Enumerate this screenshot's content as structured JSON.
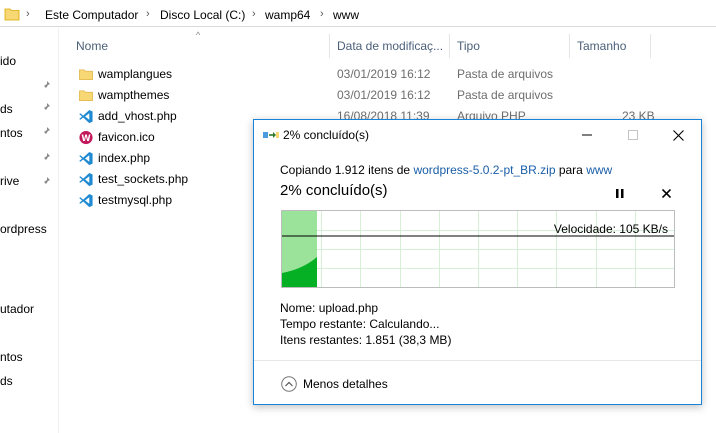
{
  "explorer": {
    "breadcrumb": [
      "Este Computador",
      "Disco Local (C:)",
      "wamp64",
      "www"
    ],
    "sidebar_items": [
      "ido",
      "ds",
      "ntos",
      "rive",
      "ordpress",
      "utador",
      "ntos",
      "ds"
    ],
    "columns": {
      "name": "Nome",
      "date": "Data de modificaç...",
      "type": "Tipo",
      "size": "Tamanho"
    },
    "files": [
      {
        "name": "wamplangues",
        "date": "03/01/2019 16:12",
        "type": "Pasta de arquivos",
        "size": "",
        "icon": "folder-icon"
      },
      {
        "name": "wampthemes",
        "date": "03/01/2019 16:12",
        "type": "Pasta de arquivos",
        "size": "",
        "icon": "folder-icon"
      },
      {
        "name": "add_vhost.php",
        "date": "16/08/2018 11:39",
        "type": "Arquivo PHP",
        "size": "23 KB",
        "icon": "vscode-file-icon"
      },
      {
        "name": "favicon.ico",
        "date": "",
        "type": "",
        "size": "",
        "icon": "ico-file-icon"
      },
      {
        "name": "index.php",
        "date": "",
        "type": "",
        "size": "",
        "icon": "vscode-file-icon"
      },
      {
        "name": "test_sockets.php",
        "date": "",
        "type": "",
        "size": "",
        "icon": "vscode-file-icon"
      },
      {
        "name": "testmysql.php",
        "date": "",
        "type": "",
        "size": "",
        "icon": "vscode-file-icon"
      }
    ]
  },
  "dialog": {
    "title": "2% concluído(s)",
    "copy_prefix": "Copiando 1.912 itens de ",
    "copy_source": "wordpress-5.0.2-pt_BR.zip",
    "copy_middle": " para ",
    "copy_dest": "www",
    "heading": "2% concluído(s)",
    "progress_fraction": 0.02,
    "speed": "Velocidade: 105 KB/s",
    "name_label": "Nome:",
    "name_value": "upload.php",
    "time_label": "Tempo restante:",
    "time_value": "Calculando...",
    "items_label": "Itens restantes:",
    "items_value": "1.851 (38,3 MB)",
    "less_details": "Menos detalhes",
    "colors": {
      "accent": "#1883d7",
      "progress_fill": "#06b025",
      "progress_light": "#9be39b",
      "link": "#1a5ea8"
    }
  }
}
